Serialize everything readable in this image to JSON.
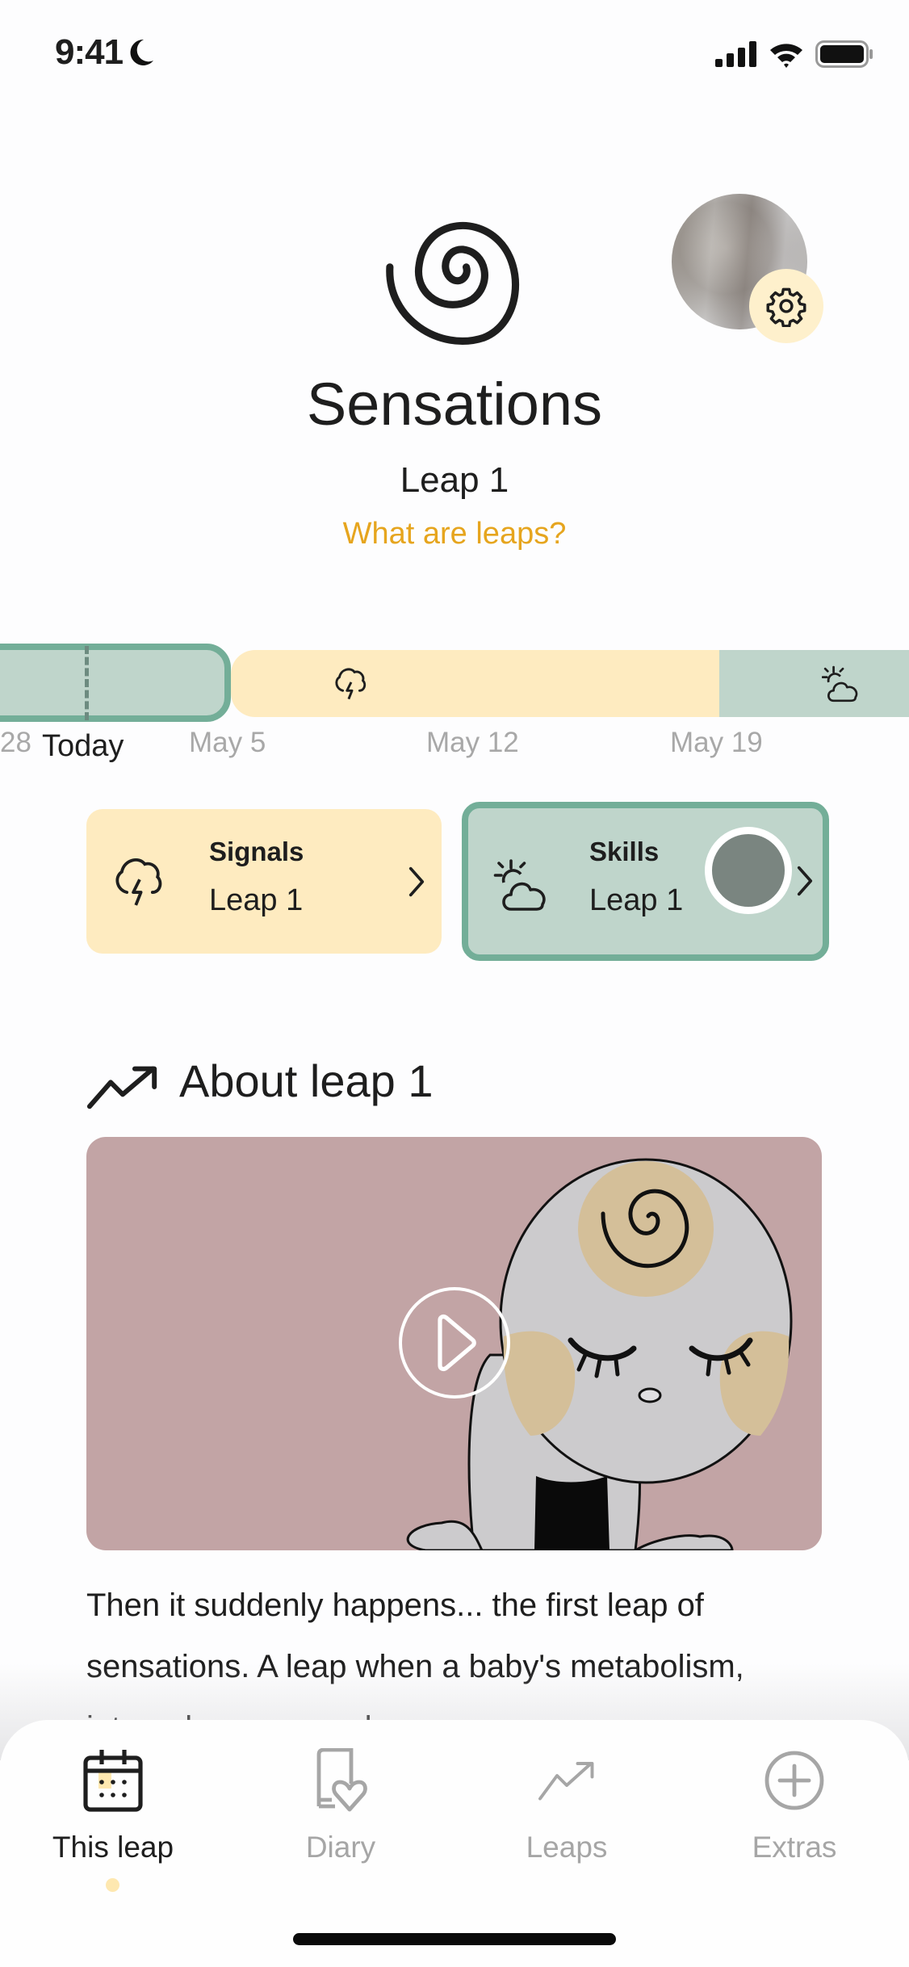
{
  "status_bar": {
    "time": "9:41",
    "icons": [
      "moon-icon",
      "signal-icon",
      "wifi-icon",
      "battery-icon"
    ]
  },
  "header": {
    "leap_icon": "spiral-icon",
    "title": "Sensations",
    "subtitle": "Leap 1",
    "link": "What are leaps?",
    "settings_icon": "gear-icon"
  },
  "timeline": {
    "segments": [
      {
        "type": "current",
        "color": "#BFD5CB",
        "border": "#73AE98"
      },
      {
        "type": "signals",
        "icon": "storm-cloud-icon",
        "color": "#FEEBC0"
      },
      {
        "type": "skills",
        "icon": "sun-cloud-icon",
        "color": "#BFD5CB"
      }
    ],
    "labels": {
      "prev": "28",
      "today": "Today",
      "may5": "May 5",
      "may12": "May 12",
      "may19": "May 19"
    }
  },
  "cards": {
    "signals": {
      "title": "Signals",
      "subtitle": "Leap 1",
      "icon": "storm-cloud-icon"
    },
    "skills": {
      "title": "Skills",
      "subtitle": "Leap 1",
      "icon": "sun-cloud-icon"
    }
  },
  "about": {
    "title": "About leap 1",
    "icon": "trend-up-icon",
    "paragraph": "Then it suddenly happens... the first leap of sensations. A leap when a baby's metabolism, internal organs, and senses"
  },
  "tabbar": {
    "tabs": [
      {
        "label": "This leap",
        "icon": "calendar-icon",
        "active": true
      },
      {
        "label": "Diary",
        "icon": "diary-heart-icon",
        "active": false
      },
      {
        "label": "Leaps",
        "icon": "trend-up-icon",
        "active": false
      },
      {
        "label": "Extras",
        "icon": "plus-circle-icon",
        "active": false
      }
    ]
  },
  "colors": {
    "accent_yellow": "#E6A51E",
    "signals_bg": "#FEEBC0",
    "skills_bg": "#BFD5CB",
    "skills_border": "#73AE98",
    "video_bg": "#C2A4A5"
  }
}
